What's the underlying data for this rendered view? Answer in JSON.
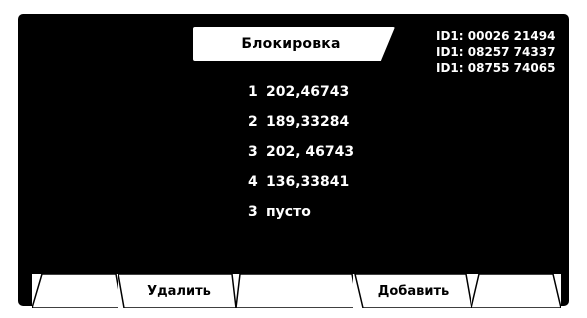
{
  "screen": {
    "title": "Блокировка",
    "ids": [
      "ID1: 00026 21494",
      "ID1: 08257 74337",
      "ID1: 08755 74065"
    ],
    "list": [
      {
        "num": "1",
        "value": "202,46743"
      },
      {
        "num": "2",
        "value": "189,33284"
      },
      {
        "num": "3",
        "value": "202, 46743"
      },
      {
        "num": "4",
        "value": "136,33841"
      },
      {
        "num": "3",
        "value": "пусто"
      }
    ],
    "softkeys": [
      "",
      "Удалить",
      "",
      "Добавить",
      ""
    ]
  },
  "colors": {
    "background": "#000000",
    "text": "#ffffff",
    "tab": "#ffffff"
  }
}
